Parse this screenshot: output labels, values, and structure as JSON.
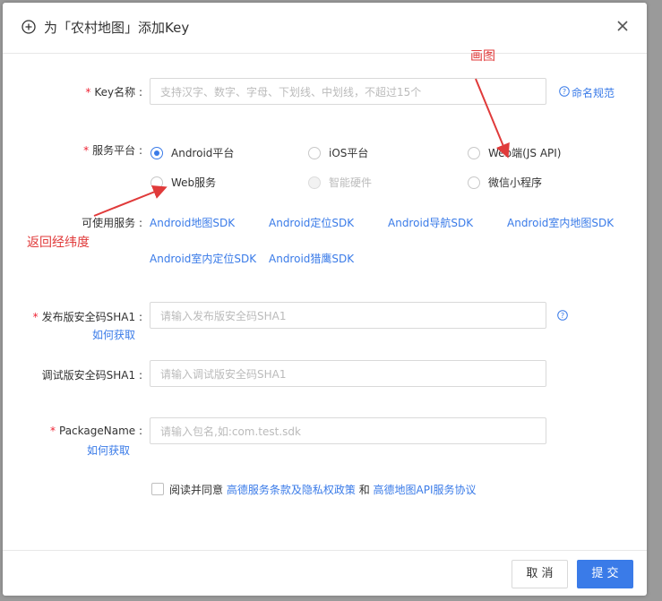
{
  "dialog": {
    "title": "为「农村地图」添加Key",
    "close_icon": "close-icon",
    "title_icon": "plus-circle-icon"
  },
  "form": {
    "key_name": {
      "required_mark": "*",
      "label": "Key名称 :",
      "placeholder": "支持汉字、数字、字母、下划线、中划线，不超过15个",
      "help_link": "命名规范"
    },
    "platform": {
      "required_mark": "*",
      "label": "服务平台 :",
      "options": [
        {
          "label": "Android平台",
          "checked": true,
          "disabled": false
        },
        {
          "label": "iOS平台",
          "checked": false,
          "disabled": false
        },
        {
          "label": "Web端(JS API)",
          "checked": false,
          "disabled": false
        },
        {
          "label": "Web服务",
          "checked": false,
          "disabled": false
        },
        {
          "label": "智能硬件",
          "checked": false,
          "disabled": true
        },
        {
          "label": "微信小程序",
          "checked": false,
          "disabled": false
        }
      ]
    },
    "services": {
      "label": "可使用服务 :",
      "items": [
        "Android地图SDK",
        "Android定位SDK",
        "Android导航SDK",
        "Android室内地图SDK",
        "Android室内定位SDK",
        "Android猎鹰SDK"
      ]
    },
    "release_sha1": {
      "required_mark": "*",
      "label": "发布版安全码SHA1 :",
      "placeholder": "请输入发布版安全码SHA1",
      "how_to_get": "如何获取"
    },
    "debug_sha1": {
      "label": "调试版安全码SHA1 :",
      "placeholder": "请输入调试版安全码SHA1"
    },
    "package_name": {
      "required_mark": "*",
      "label": "PackageName :",
      "placeholder": "请输入包名,如:com.test.sdk",
      "how_to_get": "如何获取"
    },
    "agreement": {
      "prefix": "阅读并同意",
      "link1": "高德服务条款及隐私权政策",
      "conj": "和",
      "link2": "高德地图API服务协议"
    }
  },
  "annotations": {
    "draw_map": "画图",
    "return_coords": "返回经纬度"
  },
  "buttons": {
    "cancel": "取 消",
    "submit": "提 交"
  },
  "colors": {
    "accent": "#3a7be8",
    "annotation": "#e03a3a"
  }
}
